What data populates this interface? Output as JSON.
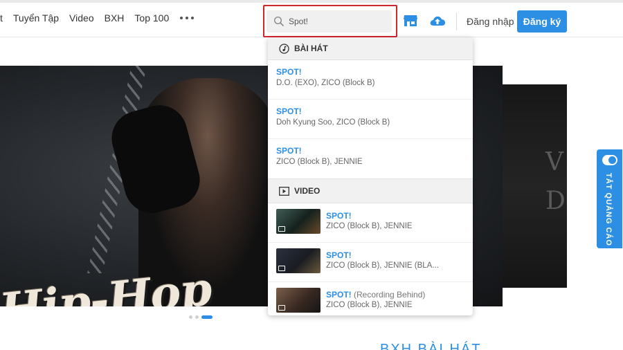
{
  "nav": {
    "items": [
      "t",
      "Tuyển Tập",
      "Video",
      "BXH",
      "Top 100"
    ]
  },
  "search": {
    "value": "Spot!",
    "placeholder": "Spot!"
  },
  "header": {
    "login_label": "Đăng nhập",
    "register_label": "Đăng ký"
  },
  "banner": {
    "title": "Hip-Hop",
    "side_text_1": "V",
    "side_text_2": "D"
  },
  "suggest": {
    "songs_label": "BÀI HÁT",
    "videos_label": "VIDEO",
    "songs": [
      {
        "title": "SPOT!",
        "artist": "D.O. (EXO), ZICO (Block B)"
      },
      {
        "title": "SPOT!",
        "artist": "Doh Kyung Soo, ZICO (Block B)"
      },
      {
        "title": "SPOT!",
        "artist": "ZICO (Block B), JENNIE"
      }
    ],
    "videos": [
      {
        "title": "SPOT!",
        "subtitle": "",
        "artist": "ZICO (Block B), JENNIE"
      },
      {
        "title": "SPOT!",
        "subtitle": "",
        "artist": "ZICO (Block B), JENNIE (BLA..."
      },
      {
        "title": "SPOT!",
        "subtitle": "(Recording Behind)",
        "artist": "ZICO (Block B), JENNIE"
      }
    ]
  },
  "ad_toggle": {
    "label": "TẮT QUẢNG CÁO"
  },
  "section_peek": "BXH BÀI HÁT",
  "colors": {
    "accent": "#2d8fe3",
    "highlight": "#d3242b"
  }
}
